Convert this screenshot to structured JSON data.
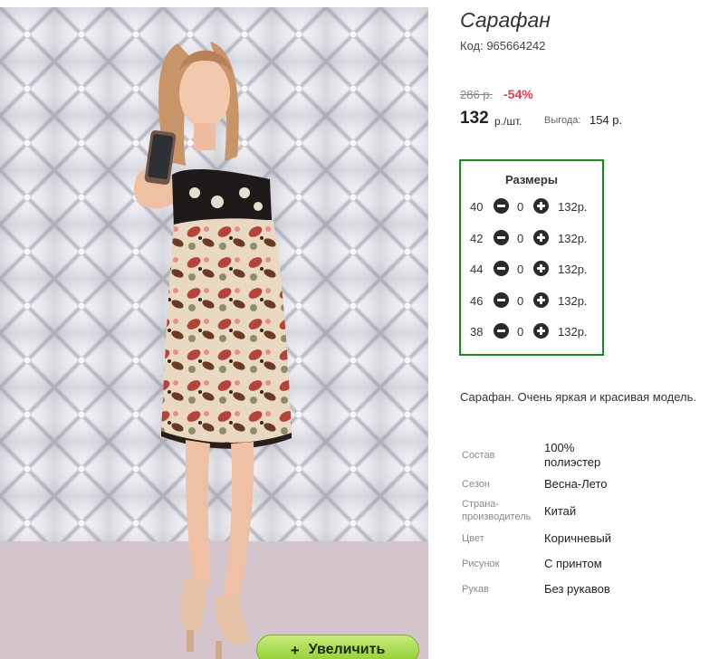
{
  "product": {
    "title": "Сарафан",
    "code_text": "Код: 965664242",
    "old_price": "286 р.",
    "discount": "-54%",
    "price": "132",
    "price_unit": "р./шт.",
    "profit_label": "Выгода:",
    "profit_value": "154 р.",
    "description": "Сарафан. Очень яркая и красивая модель."
  },
  "gallery": {
    "zoom_label": "Увеличить"
  },
  "sizes": {
    "title": "Размеры",
    "items": [
      {
        "size": "40",
        "qty": "0",
        "price": "132р."
      },
      {
        "size": "42",
        "qty": "0",
        "price": "132р."
      },
      {
        "size": "44",
        "qty": "0",
        "price": "132р."
      },
      {
        "size": "46",
        "qty": "0",
        "price": "132р."
      },
      {
        "size": "38",
        "qty": "0",
        "price": "132р."
      }
    ]
  },
  "properties": [
    {
      "label": "Состав",
      "value_line1": "100%",
      "value_line2": "полиэстер"
    },
    {
      "label": "Сезон",
      "value_line1": "Весна-Лето"
    },
    {
      "label_line1": "Страна-",
      "label_line2": "производитель",
      "value_line1": "Китай"
    },
    {
      "label": "Цвет",
      "value_line1": "Коричневый"
    },
    {
      "label": "Рисунок",
      "value_line1": "С принтом"
    },
    {
      "label": "Рукав",
      "value_line1": "Без рукавов"
    }
  ],
  "colors": {
    "accent_discount": "#e23c5a",
    "sizes_border": "#1d8a1d",
    "zoom_button": "#8ccc2c"
  },
  "icons": {
    "minus": "minus-circle-icon",
    "plus": "plus-circle-icon",
    "zoom": "plus-icon"
  }
}
